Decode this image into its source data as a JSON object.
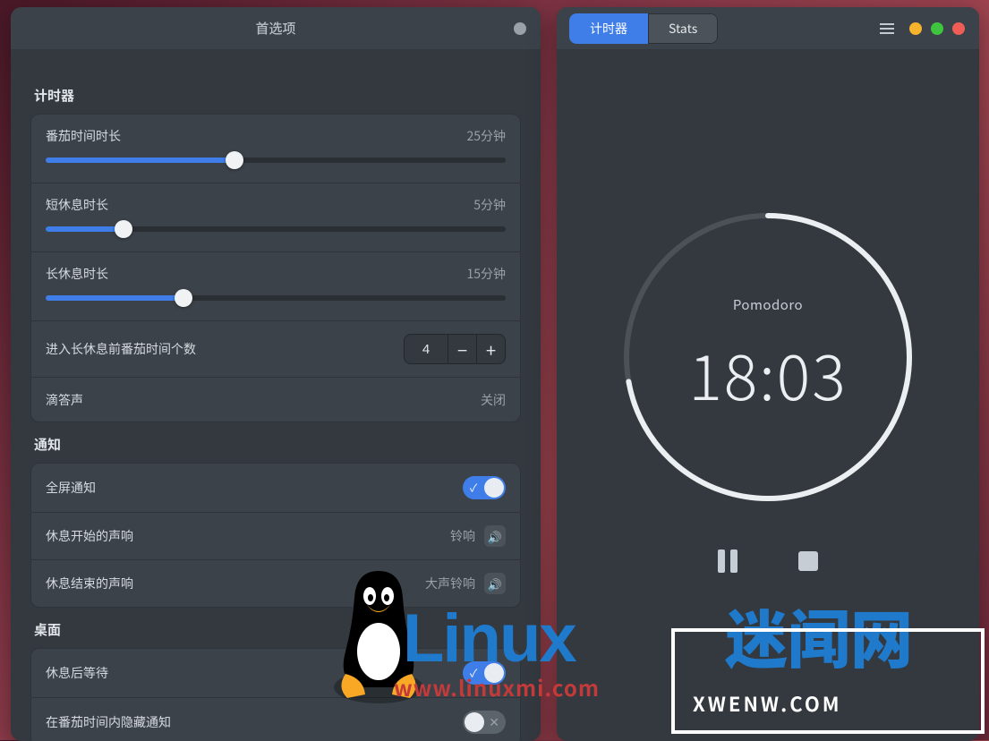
{
  "prefs": {
    "title": "首选项",
    "sections": {
      "timer": {
        "title": "计时器",
        "pomodoro": {
          "label": "番茄时间时长",
          "value": "25分钟",
          "percent": 41
        },
        "short": {
          "label": "短休息时长",
          "value": "5分钟",
          "percent": 17
        },
        "long": {
          "label": "长休息时长",
          "value": "15分钟",
          "percent": 30
        },
        "before_long": {
          "label": "进入长休息前番茄时间个数",
          "value": "4"
        },
        "tick": {
          "label": "滴答声",
          "value": "关闭"
        }
      },
      "notify": {
        "title": "通知",
        "fullscreen": {
          "label": "全屏通知"
        },
        "start_sound": {
          "label": "休息开始的声响",
          "value": "铃响"
        },
        "end_sound": {
          "label": "休息结束的声响",
          "value": "大声铃响"
        }
      },
      "desktop": {
        "title": "桌面",
        "wait": {
          "label": "休息后等待"
        },
        "hide": {
          "label": "在番茄时间内隐藏通知"
        }
      }
    }
  },
  "timer": {
    "tabs": {
      "timer": "计时器",
      "stats": "Stats"
    },
    "label": "Pomodoro",
    "time": "18:03",
    "progress": 0.278
  },
  "watermark": {
    "linux": "Linux",
    "zhiwen": "迷闻网",
    "url": "www.linuxmi.com",
    "box": "XWENW.COM"
  }
}
